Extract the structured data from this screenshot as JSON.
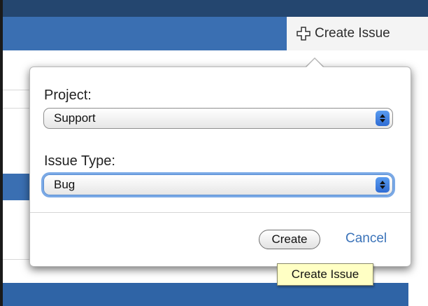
{
  "header": {
    "create_issue_label": "Create Issue"
  },
  "dialog": {
    "project": {
      "label": "Project:",
      "selected": "Support"
    },
    "issue_type": {
      "label": "Issue Type:",
      "selected": "Bug"
    },
    "create_button_label": "Create",
    "cancel_link_label": "Cancel"
  },
  "tooltip": {
    "text": "Create Issue"
  },
  "colors": {
    "header_dark": "#24466f",
    "header_blue": "#3a6fb2",
    "link": "#3b73b9",
    "focus_ring": "#7aa9e6",
    "tooltip_bg": "#ffffc4"
  },
  "icons": {
    "create_issue": "plus-icon",
    "select_stepper": "chevron-updown-icon"
  }
}
